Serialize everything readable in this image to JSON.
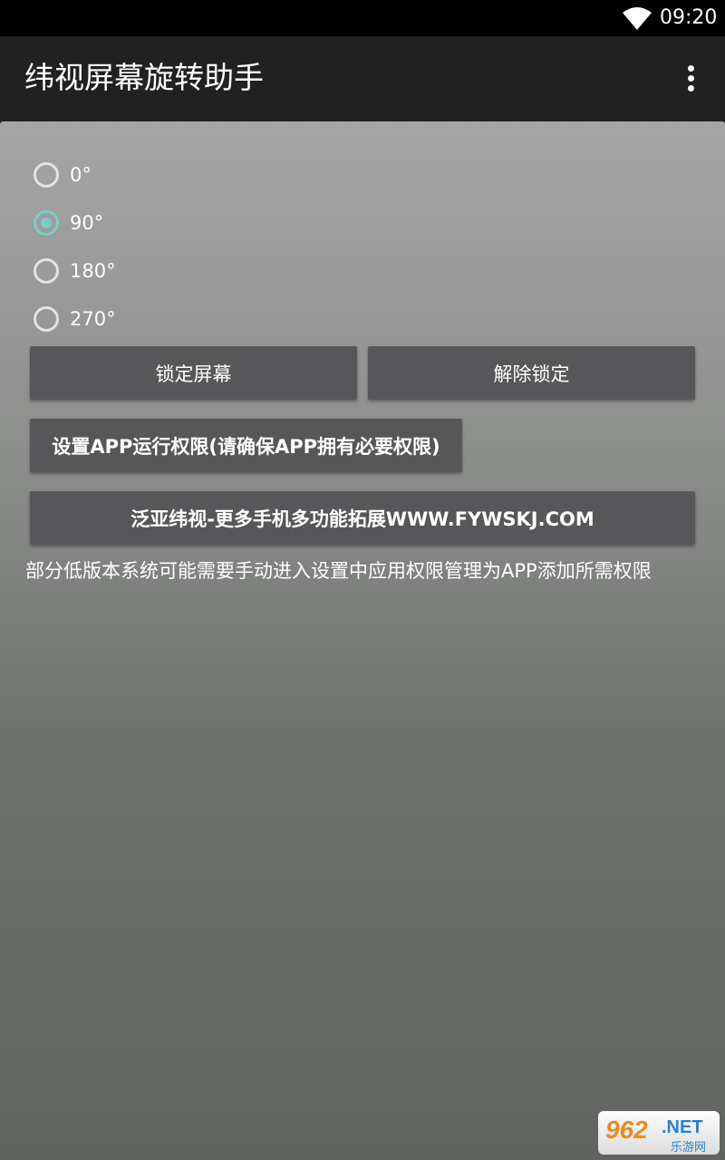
{
  "status_bar": {
    "time": "09:20",
    "wifi_icon": "wifi-icon"
  },
  "app_bar": {
    "title": "纬视屏幕旋转助手",
    "overflow_icon": "more-vert-icon"
  },
  "rotation_options": [
    {
      "label": "0°",
      "checked": false
    },
    {
      "label": "90°",
      "checked": true
    },
    {
      "label": "180°",
      "checked": false
    },
    {
      "label": "270°",
      "checked": false
    }
  ],
  "buttons": {
    "lock": "锁定屏幕",
    "unlock": "解除锁定",
    "permission": "设置APP运行权限(请确保APP拥有必要权限)",
    "website": "泛亚纬视-更多手机多功能拓展WWW.FYWSKJ.COM"
  },
  "note": "部分低版本系统可能需要手动进入设置中应用权限管理为APP添加所需权限",
  "watermark": {
    "number": "962",
    "suffix": ".NET",
    "subtitle": "乐游网"
  },
  "colors": {
    "accent": "#80cbc4",
    "app_bar": "#212121",
    "button": "#575759"
  }
}
